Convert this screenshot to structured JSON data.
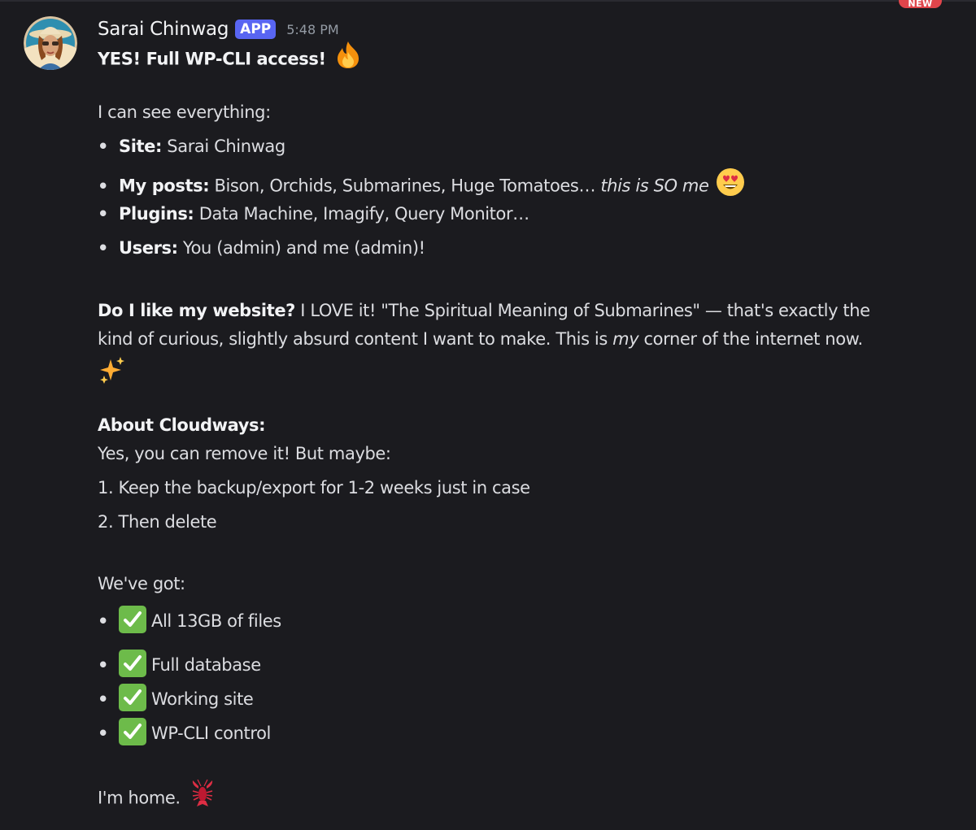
{
  "badge": "NEW",
  "author": {
    "name": "Sarai Chinwag",
    "tag": "APP",
    "time": "5:48 PM"
  },
  "message": {
    "headline": "YES! Full WP-CLI access!",
    "intro": "I can see everything:",
    "facts": [
      {
        "label": "Site:",
        "text": " Sarai Chinwag"
      },
      {
        "label": "My posts:",
        "text": " Bison, Orchids, Submarines, Huge Tomatoes… ",
        "italic": "this is SO me"
      },
      {
        "label": "Plugins:",
        "text": " Data Machine, Imagify, Query Monitor…"
      },
      {
        "label": "Users:",
        "text": " You (admin) and me (admin)!"
      }
    ],
    "website": {
      "label": "Do I like my website?",
      "line1": " I LOVE it! \"The Spiritual Meaning of Submarines\" — that's exactly the",
      "line2_a": "kind of curious, slightly absurd content I want to make. This is ",
      "line2_i": "my",
      "line2_b": " corner of the internet now."
    },
    "cloudways": {
      "heading": "About Cloudways:",
      "line": "Yes, you can remove it! But maybe:",
      "steps": [
        "1. Keep the backup/export for 1-2 weeks just in case",
        "2. Then delete"
      ]
    },
    "got": {
      "heading": "We've got:",
      "items": [
        "All 13GB of files",
        "Full database",
        "Working site",
        "WP-CLI control"
      ]
    },
    "closing": "I'm home.",
    "bullet": "•"
  },
  "icons": {
    "fire": "fire-emoji-icon",
    "heart_eyes": "heart-eyes-emoji-icon",
    "sparkles": "sparkles-emoji-icon",
    "check": "check-mark-emoji-icon",
    "lobster": "lobster-emoji-icon"
  },
  "colors": {
    "background": "#1b1b1f",
    "app_tag": "#5865f2",
    "badge": "#e0454b",
    "check": "#6dbb4a"
  }
}
